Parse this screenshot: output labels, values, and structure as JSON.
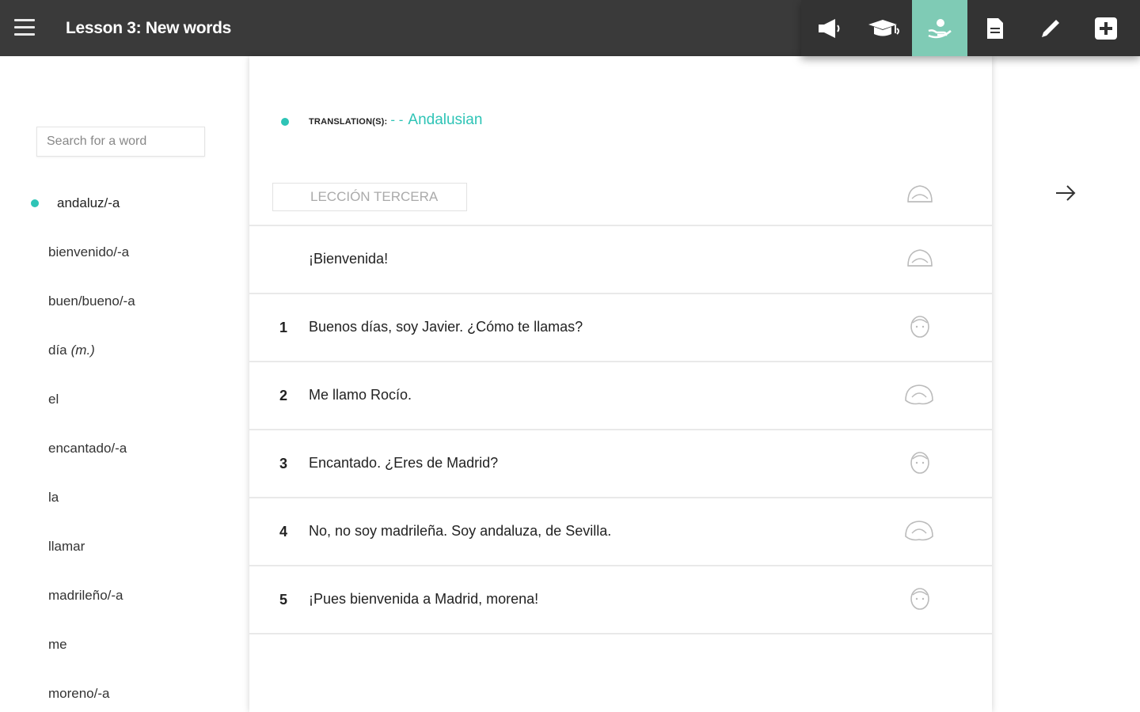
{
  "header": {
    "title": "Lesson 3: New words",
    "toolbar": [
      {
        "icon": "megaphone-icon",
        "active": false
      },
      {
        "icon": "graduation-cap-icon",
        "active": false
      },
      {
        "icon": "hand-icon",
        "active": true
      },
      {
        "icon": "document-icon",
        "active": false
      },
      {
        "icon": "pencil-icon",
        "active": false
      },
      {
        "icon": "plus-box-icon",
        "active": false
      }
    ],
    "active_color": "#7fcbb5"
  },
  "sidebar": {
    "search_placeholder": "Search for a word",
    "words": [
      {
        "word": "andaluz/-a",
        "gram": ""
      },
      {
        "word": "bienvenido/-a",
        "gram": ""
      },
      {
        "word": "buen/bueno/-a",
        "gram": ""
      },
      {
        "word": "día",
        "gram": "(m.)"
      },
      {
        "word": "el",
        "gram": ""
      },
      {
        "word": "encantado/-a",
        "gram": ""
      },
      {
        "word": "la",
        "gram": ""
      },
      {
        "word": "llamar",
        "gram": ""
      },
      {
        "word": "madrileño/-a",
        "gram": ""
      },
      {
        "word": "me",
        "gram": ""
      },
      {
        "word": "moreno/-a",
        "gram": ""
      }
    ],
    "selected_index": 0
  },
  "main": {
    "translation_label": "TRANSLATION(S):",
    "translation_sep": "- -",
    "translation_value": "Andalusian",
    "lesson_tag": "LECCIÓN TERCERA",
    "title_sentence": "¡Bienvenida!",
    "sentences": [
      {
        "num": "1",
        "text": "Buenos días, soy Javier. ¿Cómo te llamas?",
        "speaker": "male-head-icon"
      },
      {
        "num": "2",
        "text": "Me llamo Rocío.",
        "speaker": "female-head-icon"
      },
      {
        "num": "3",
        "text": "Encantado. ¿Eres de Madrid?",
        "speaker": "male-head-icon"
      },
      {
        "num": "4",
        "text": "No, no soy madrileña. Soy andaluza, de Sevilla.",
        "speaker": "female-head-icon"
      },
      {
        "num": "5",
        "text": "¡Pues bienvenida a Madrid, morena!",
        "speaker": "male-head-icon"
      }
    ],
    "accent_color": "#2ec4b6"
  }
}
